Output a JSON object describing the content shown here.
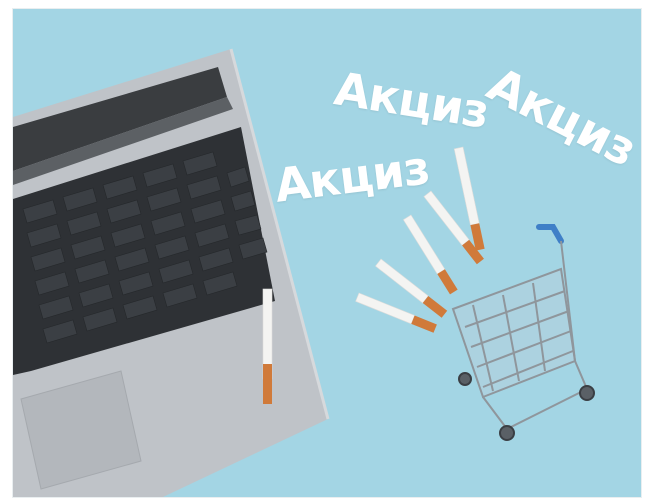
{
  "image": {
    "description_colors": {
      "background": "#9fd3e2",
      "laptop_body": "#b9bdc2",
      "keyboard": "#2c2f33",
      "cigarette_filter": "#d07a3a",
      "cart_handle": "#3f7fc7"
    }
  },
  "overlay": {
    "words": [
      "Акциз",
      "Акциз",
      "Акциз"
    ]
  }
}
